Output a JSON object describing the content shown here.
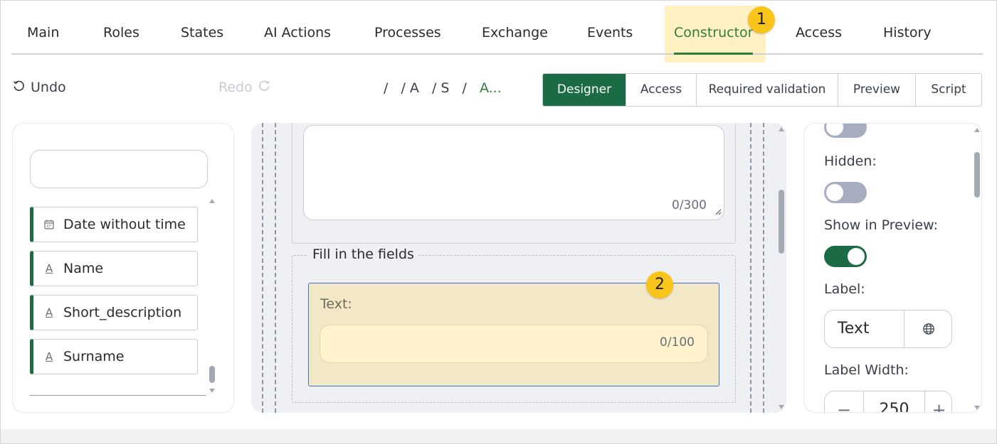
{
  "tabs": [
    {
      "label": "Main"
    },
    {
      "label": "Roles"
    },
    {
      "label": "States"
    },
    {
      "label": "AI Actions"
    },
    {
      "label": "Processes"
    },
    {
      "label": "Exchange"
    },
    {
      "label": "Events"
    },
    {
      "label": "Constructor",
      "active": true
    },
    {
      "label": "Access"
    },
    {
      "label": "History"
    }
  ],
  "badges": {
    "one": "1",
    "two": "2"
  },
  "toolbar": {
    "undo_label": "Undo",
    "redo_label": "Redo",
    "breadcrumb": [
      "/",
      "/ A",
      "/ S",
      "/",
      "A..."
    ],
    "views": [
      {
        "label": "Designer",
        "active": true
      },
      {
        "label": "Access"
      },
      {
        "label": "Required validation"
      },
      {
        "label": "Preview"
      },
      {
        "label": "Script"
      }
    ]
  },
  "field_palette": {
    "search_value": "",
    "items": [
      {
        "label": "Date without time",
        "icon": "calendar-icon"
      },
      {
        "label": "Name",
        "icon": "text-type-icon"
      },
      {
        "label": "Short_description",
        "icon": "text-type-icon"
      },
      {
        "label": "Surname",
        "icon": "text-type-icon"
      }
    ]
  },
  "canvas": {
    "textarea_counter": "0/300",
    "fieldset_legend": "Fill in the fields",
    "selected_field": {
      "label": "Text:",
      "counter": "0/100"
    }
  },
  "properties": {
    "hidden_label": "Hidden:",
    "hidden_on": false,
    "show_in_preview_label": "Show in Preview:",
    "show_in_preview_on": true,
    "label_label": "Label:",
    "label_value": "Text",
    "label_width_label": "Label Width:",
    "label_width_value": "250",
    "minus": "−",
    "plus": "+"
  },
  "colors": {
    "accent": "#1b6b45",
    "active_tab": "#2e7d3a",
    "highlight": "#f9c51a",
    "selected_field_bg": "#f3e8c6"
  }
}
